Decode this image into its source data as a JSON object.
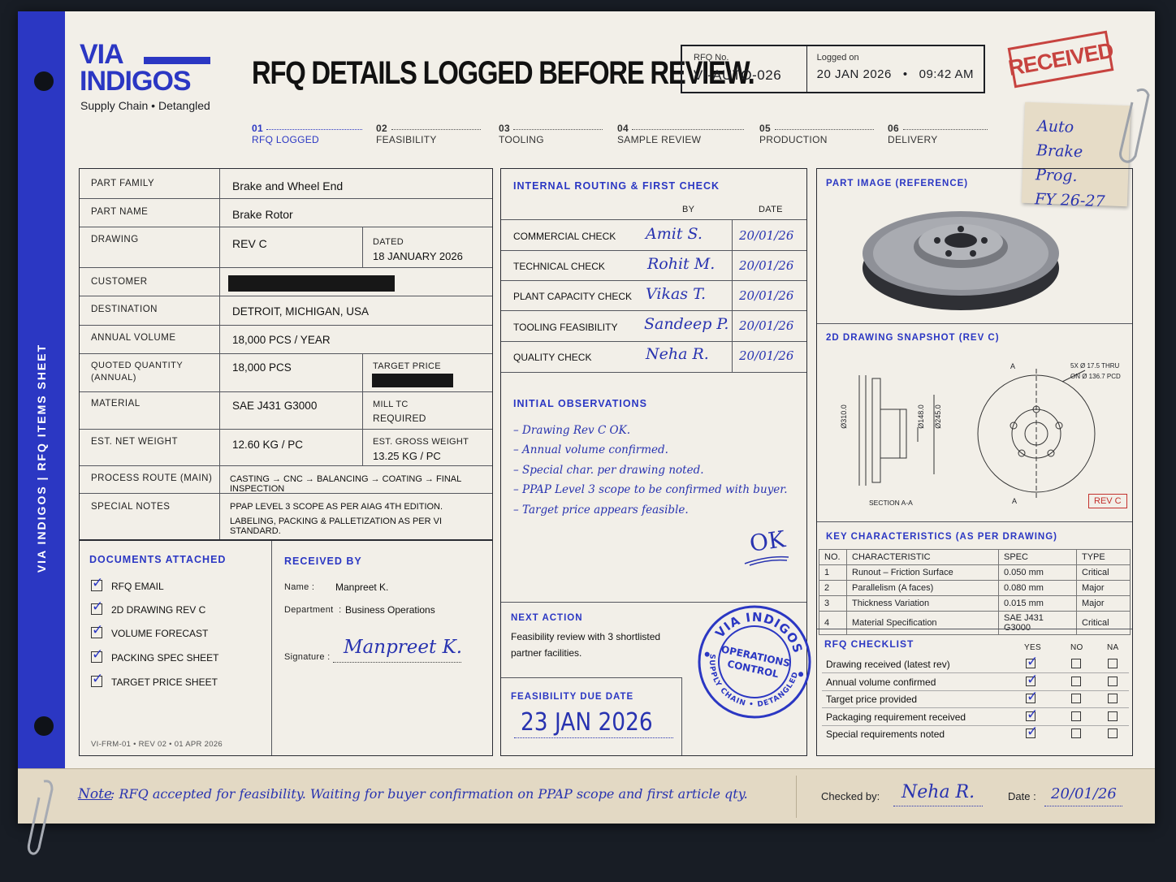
{
  "brand": {
    "line1": "VIA",
    "line2": "INDIGOS",
    "tagline": "Supply Chain • Detangled",
    "side_text": "VIA INDIGOS   |   RFQ ITEMS SHEET"
  },
  "title": "RFQ DETAILS LOGGED BEFORE REVIEW.",
  "rfq": {
    "no_label": "RFQ No.",
    "no_value": "VI-AUTO-026",
    "logged_label": "Logged on",
    "logged_value": "20 JAN 2026   •   09:42 AM"
  },
  "stamp": "RECEIVED",
  "sticky_note": {
    "line1": "Auto",
    "line2": "Brake Prog.",
    "line3": "FY 26-27"
  },
  "steps": [
    {
      "num": "01",
      "label": "RFQ LOGGED"
    },
    {
      "num": "02",
      "label": "FEASIBILITY"
    },
    {
      "num": "03",
      "label": "TOOLING"
    },
    {
      "num": "04",
      "label": "SAMPLE REVIEW"
    },
    {
      "num": "05",
      "label": "PRODUCTION"
    },
    {
      "num": "06",
      "label": "DELIVERY"
    }
  ],
  "part": {
    "family_label": "PART FAMILY",
    "family": "Brake and Wheel End",
    "name_label": "PART NAME",
    "name": "Brake Rotor",
    "drawing_label": "DRAWING",
    "drawing": "REV C",
    "dated_label": "DATED",
    "dated": "18 JANUARY 2026",
    "customer_label": "CUSTOMER",
    "destination_label": "DESTINATION",
    "destination": "DETROIT, MICHIGAN, USA",
    "volume_label": "ANNUAL VOLUME",
    "volume": "18,000 PCS / YEAR",
    "qty_label1": "QUOTED QUANTITY",
    "qty_label2": "(ANNUAL)",
    "qty": "18,000 PCS",
    "target_label": "TARGET PRICE",
    "material_label": "MATERIAL",
    "material": "SAE J431 G3000",
    "mill_label": "MILL TC",
    "mill": "REQUIRED",
    "net_label": "EST. NET WEIGHT",
    "net": "12.60 KG / PC",
    "gross_label": "EST. GROSS WEIGHT",
    "gross": "13.25 KG / PC",
    "route_label": "PROCESS ROUTE (MAIN)",
    "route": "CASTING → CNC → BALANCING → COATING → FINAL INSPECTION",
    "notes_label": "SPECIAL NOTES",
    "notes1": "PPAP LEVEL 3 SCOPE AS PER AIAG 4TH EDITION.",
    "notes2": "LABELING, PACKING & PALLETIZATION AS PER VI STANDARD."
  },
  "documents": {
    "title": "DOCUMENTS ATTACHED",
    "items": [
      "RFQ EMAIL",
      "2D DRAWING REV C",
      "VOLUME FORECAST",
      "PACKING SPEC SHEET",
      "TARGET PRICE SHEET"
    ],
    "footer": "VI-FRM-01 • REV 02 • 01 APR 2026"
  },
  "received": {
    "title": "RECEIVED BY",
    "name_label": "Name :",
    "name": "Manpreet K.",
    "dept_label": "Department  :",
    "dept": "Business Operations",
    "sig_label": "Signature :",
    "signature": "Manpreet K."
  },
  "routing": {
    "title": "INTERNAL ROUTING & FIRST CHECK",
    "by_label": "BY",
    "date_label": "DATE",
    "rows": [
      {
        "check": "COMMERCIAL CHECK",
        "by": "Amit S.",
        "date": "20/01/26"
      },
      {
        "check": "TECHNICAL CHECK",
        "by": "Rohit M.",
        "date": "20/01/26"
      },
      {
        "check": "PLANT CAPACITY CHECK",
        "by": "Vikas T.",
        "date": "20/01/26"
      },
      {
        "check": "TOOLING FEASIBILITY",
        "by": "Sandeep P.",
        "date": "20/01/26"
      },
      {
        "check": "QUALITY CHECK",
        "by": "Neha R.",
        "date": "20/01/26"
      }
    ]
  },
  "observations": {
    "title": "INITIAL OBSERVATIONS",
    "items": [
      "– Drawing Rev C OK.",
      "– Annual volume confirmed.",
      "– Special char. per drawing noted.",
      "– PPAP Level 3 scope to be confirmed with buyer.",
      "– Target price appears feasible."
    ],
    "ok": "OK"
  },
  "next_action": {
    "title": "NEXT ACTION",
    "text1": "Feasibility review with 3 shortlisted",
    "text2": "partner facilities."
  },
  "due": {
    "title": "FEASIBILITY DUE DATE",
    "value": "23 JAN 2026"
  },
  "ops_stamp": {
    "top": "VIA INDIGOS",
    "center1": "OPERATIONS",
    "center2": "CONTROL",
    "bottom": "SUPPLY CHAIN • DETANGLED"
  },
  "image_panel": {
    "title": "PART IMAGE (REFERENCE)"
  },
  "drawing_panel": {
    "title": "2D DRAWING SNAPSHOT (REV C)",
    "d1": "Ø310.0",
    "d2": "Ø148.0",
    "d3": "Ø245.0",
    "section": "SECTION A-A",
    "holes1": "5X Ø 17.5 THRU",
    "holes2": "ON Ø 136.7 PCD",
    "a": "A",
    "rev": "REV C"
  },
  "key_chars": {
    "title": "KEY CHARACTERISTICS (AS PER DRAWING)",
    "headers": [
      "NO.",
      "CHARACTERISTIC",
      "SPEC",
      "TYPE"
    ],
    "rows": [
      [
        "1",
        "Runout – Friction Surface",
        "0.050 mm",
        "Critical"
      ],
      [
        "2",
        "Parallelism (A faces)",
        "0.080 mm",
        "Major"
      ],
      [
        "3",
        "Thickness Variation",
        "0.015 mm",
        "Major"
      ],
      [
        "4",
        "Material Specification",
        "SAE J431 G3000",
        "Critical"
      ]
    ]
  },
  "checklist": {
    "title": "RFQ CHECKLIST",
    "yes": "YES",
    "no": "NO",
    "na": "NA",
    "items": [
      "Drawing received (latest rev)",
      "Annual volume confirmed",
      "Target price provided",
      "Packaging requirement received",
      "Special requirements noted"
    ]
  },
  "footer": {
    "note_label": "Note",
    "note": ": RFQ accepted for feasibility. Waiting for buyer confirmation on PPAP scope and first article qty.",
    "checked_label": "Checked by:",
    "checked": "Neha R.",
    "date_label": "Date :",
    "date": "20/01/26"
  },
  "colors": {
    "accent": "#2b37c3",
    "stamp_red": "#c3312d",
    "ink": "#2833b0"
  }
}
